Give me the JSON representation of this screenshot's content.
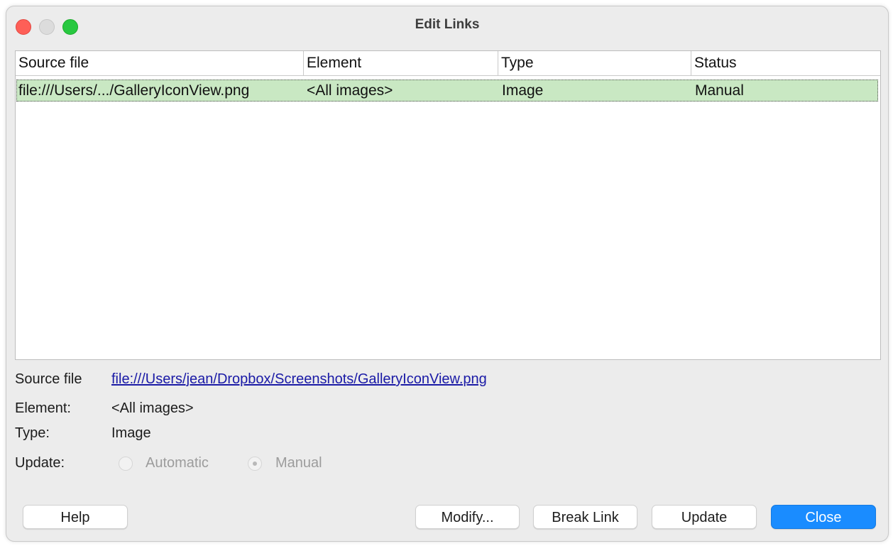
{
  "window": {
    "title": "Edit Links"
  },
  "table": {
    "columns": [
      "Source file",
      "Element",
      "Type",
      "Status"
    ],
    "rows": [
      {
        "source_file": "file:///Users/.../GalleryIconView.png",
        "element": "<All images>",
        "type": "Image",
        "status": "Manual",
        "selected": true
      }
    ]
  },
  "details": {
    "source_file_label": "Source file",
    "source_file_value": "file:///Users/jean/Dropbox/Screenshots/GalleryIconView.png",
    "element_label": "Element:",
    "element_value": "<All images>",
    "type_label": "Type:",
    "type_value": "Image",
    "update_label": "Update:",
    "update_options": [
      {
        "label": "Automatic",
        "checked": false,
        "enabled": false
      },
      {
        "label": "Manual",
        "checked": true,
        "enabled": false
      }
    ]
  },
  "buttons": {
    "help": "Help",
    "modify": "Modify...",
    "break_link": "Break Link",
    "update": "Update",
    "close": "Close"
  },
  "colors": {
    "selected_row": "#c9e8c3",
    "primary_button": "#1a8cff",
    "link": "#1a1aa6",
    "traffic_close": "#fe5f57",
    "traffic_zoom": "#28c840"
  }
}
